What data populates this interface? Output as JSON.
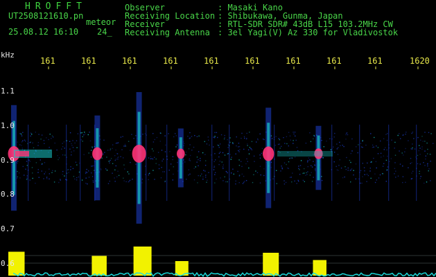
{
  "header": {
    "station": "HROFFT",
    "filename": "UT2508121610.pn",
    "mode": "meteor",
    "datetime": "25.08.12 16:10",
    "duration": "24_",
    "rows": [
      {
        "label": "Observer",
        "value": ": Masaki Kano"
      },
      {
        "label": "Receiving Location",
        "value": ": Shibukawa, Gunma, Japan"
      },
      {
        "label": "Receiver",
        "value": ": RTL-SDR SDR# 43dB L15 103.2MHz CW"
      },
      {
        "label": "Receiving Antenna",
        "value": ": 3el Yagi(V) Az 330 for Vladivostok"
      }
    ]
  },
  "time_axis": {
    "ticks": [
      "161",
      "161",
      "161",
      "161",
      "161",
      "161",
      "161",
      "161",
      "161",
      "1620"
    ]
  },
  "freq_axis": {
    "unit": "kHz",
    "ticks": [
      "1.1",
      "1.0",
      "0.9",
      "0.8",
      "0.7",
      "0.6"
    ]
  },
  "colors": {
    "background": "#000000",
    "tick_color": "#e8e84a",
    "header_green": "#49d649",
    "signal_core": "#ff3377",
    "signal_mid": "#18c7c7",
    "signal_low": "#1d3fd0",
    "echo_power": "#f2f200",
    "noise_floor": "#18e0e0"
  },
  "echoes": [
    {
      "time_min": 16.1,
      "strength": 0.75
    },
    {
      "time_min": 16.12,
      "strength": 0.55
    },
    {
      "time_min": 16.13,
      "strength": 1.0
    },
    {
      "time_min": 16.14,
      "strength": 0.3
    },
    {
      "time_min": 16.161,
      "strength": 0.7
    },
    {
      "time_min": 16.173,
      "strength": 0.35
    }
  ]
}
